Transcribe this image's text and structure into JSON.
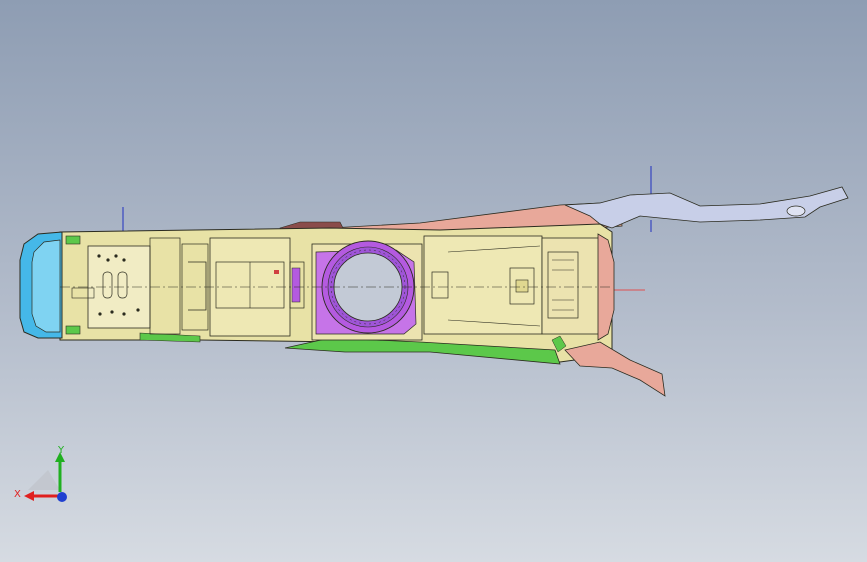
{
  "viewport": {
    "background_top": "#8e9db3",
    "background_bottom": "#d6dbe2"
  },
  "model": {
    "colors": {
      "body_fill": "#e8e2a6",
      "outline": "#2b2b1f",
      "magenta_ring": "#b45ae0",
      "cyan_cap": "#45b8e8",
      "green_trim": "#5cc84a",
      "salmon_trim": "#e8a89a",
      "lavender_arm": "#c8cfe8",
      "maroon_trim": "#8a4c4a"
    }
  },
  "triad": {
    "x_label": "X",
    "y_label": "Y",
    "x_color": "#e02020",
    "y_color": "#20b020",
    "z_color": "#2040d0"
  }
}
